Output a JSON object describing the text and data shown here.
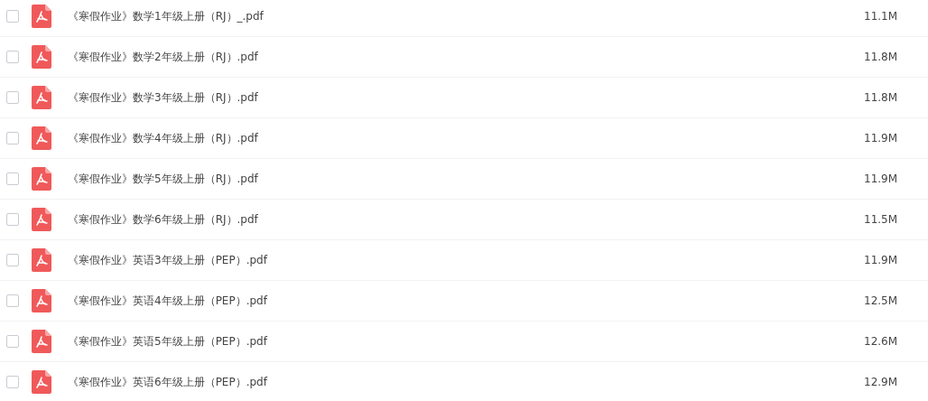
{
  "files": [
    {
      "name": "《寒假作业》数学1年级上册（RJ）_.pdf",
      "size": "11.1M",
      "checked": false
    },
    {
      "name": "《寒假作业》数学2年级上册（RJ）.pdf",
      "size": "11.8M",
      "checked": false
    },
    {
      "name": "《寒假作业》数学3年级上册（RJ）.pdf",
      "size": "11.8M",
      "checked": false
    },
    {
      "name": "《寒假作业》数学4年级上册（RJ）.pdf",
      "size": "11.9M",
      "checked": false
    },
    {
      "name": "《寒假作业》数学5年级上册（RJ）.pdf",
      "size": "11.9M",
      "checked": false
    },
    {
      "name": "《寒假作业》数学6年级上册（RJ）.pdf",
      "size": "11.5M",
      "checked": false
    },
    {
      "name": "《寒假作业》英语3年级上册（PEP）.pdf",
      "size": "11.9M",
      "checked": false
    },
    {
      "name": "《寒假作业》英语4年级上册（PEP）.pdf",
      "size": "12.5M",
      "checked": false
    },
    {
      "name": "《寒假作业》英语5年级上册（PEP）.pdf",
      "size": "12.6M",
      "checked": false
    },
    {
      "name": "《寒假作业》英语6年级上册（PEP）.pdf",
      "size": "12.9M",
      "checked": false
    }
  ]
}
